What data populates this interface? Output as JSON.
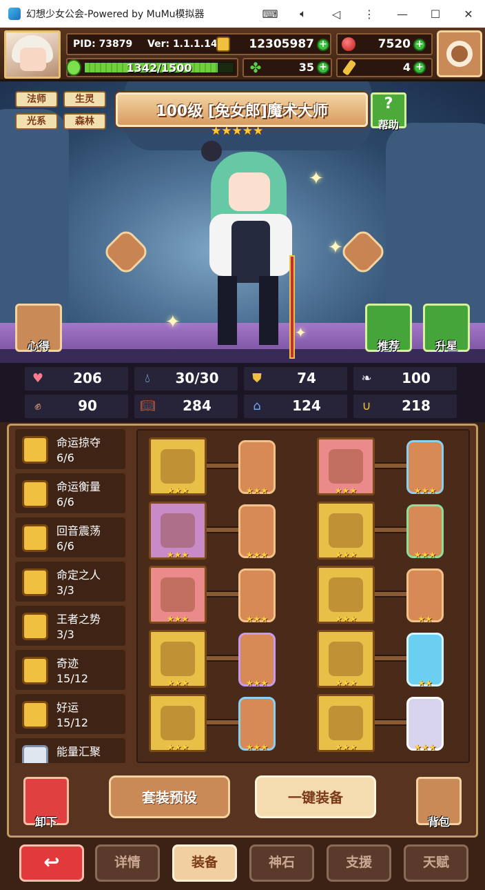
{
  "window": {
    "title": "幻想少女公会-Powered by MuMu模拟器",
    "controls": [
      "keyboard-icon",
      "volume-icon",
      "back-icon",
      "more-icon",
      "minimize-icon",
      "maximize-icon",
      "close-icon"
    ]
  },
  "resources": {
    "pid": "PID: 73879",
    "version": "Ver: 1.1.1.14",
    "gold": "12305987",
    "gems": "7520",
    "energy_text": "1342/1500",
    "energy_current": 1342,
    "energy_max": 1500,
    "clover": "35",
    "keys": "4"
  },
  "hero": {
    "tags": [
      "法师",
      "生灵",
      "光系",
      "森林"
    ],
    "title": "100级 [兔女郎]魔术大师",
    "stars": 5,
    "help_label": "帮助",
    "insight_label": "心得",
    "recommend_label": "推荐",
    "starup_label": "升星"
  },
  "stats": [
    {
      "icon": "heart-icon",
      "value": "206"
    },
    {
      "icon": "water-drop-icon",
      "value": "30/30"
    },
    {
      "icon": "shield-icon",
      "value": "74"
    },
    {
      "icon": "wing-icon",
      "value": "100"
    },
    {
      "icon": "fist-icon",
      "value": "90"
    },
    {
      "icon": "book-icon",
      "value": "284"
    },
    {
      "icon": "boot-icon",
      "value": "124"
    },
    {
      "icon": "horseshoe-icon",
      "value": "218"
    }
  ],
  "sets": [
    {
      "name": "命运掠夺",
      "count": "6/6"
    },
    {
      "name": "命运衡量",
      "count": "6/6"
    },
    {
      "name": "回音震荡",
      "count": "6/6"
    },
    {
      "name": "命定之人",
      "count": "3/3"
    },
    {
      "name": "王者之势",
      "count": "3/3"
    },
    {
      "name": "奇迹",
      "count": "15/12"
    },
    {
      "name": "好运",
      "count": "15/12"
    },
    {
      "name": "能量汇聚",
      "count": ""
    }
  ],
  "equipment": {
    "left": [
      {
        "item": "axe-icon",
        "frame": "gold",
        "stars": "★★★",
        "rune_border": "normal",
        "rune_stars": "★★★"
      },
      {
        "item": "orb-icon",
        "frame": "purple",
        "stars": "★★★",
        "rune_border": "normal",
        "rune_stars": "★★★"
      },
      {
        "item": "necklace-icon",
        "frame": "pink",
        "stars": "★★★",
        "rune_border": "normal",
        "rune_stars": "★★★"
      },
      {
        "item": "amulet-icon",
        "frame": "gold",
        "stars": "★★★",
        "rune_border": "purple",
        "rune_stars": "★★★"
      },
      {
        "item": "ring-icon",
        "frame": "gold",
        "stars": "★★★",
        "rune_border": "blue",
        "rune_stars": "★★★"
      }
    ],
    "right": [
      {
        "item": "hat-icon",
        "frame": "pink",
        "stars": "★★★",
        "rune_border": "blue",
        "rune_stars": "★★★"
      },
      {
        "item": "armor-icon",
        "frame": "gold",
        "stars": "★★★",
        "rune_border": "green",
        "rune_stars": "★★★"
      },
      {
        "item": "bracer-icon",
        "frame": "gold",
        "stars": "★★★",
        "rune_border": "normal",
        "rune_stars": "★★"
      },
      {
        "item": "belt-icon",
        "frame": "gold",
        "stars": "★★★",
        "rune_border": "cyan",
        "rune_stars": "★★"
      },
      {
        "item": "boots-icon",
        "frame": "gold",
        "stars": "★★★",
        "rune_border": "silver",
        "rune_stars": "★★★"
      }
    ]
  },
  "actions": {
    "unequip_label": "卸下",
    "preset_label": "套装预设",
    "equip_all_label": "一键装备",
    "bag_label": "背包"
  },
  "nav": {
    "back_icon": "return-arrow-icon",
    "tabs": [
      "详情",
      "装备",
      "神石",
      "支援",
      "天赋"
    ],
    "active": "装备"
  },
  "colors": {
    "accent_gold": "#f0c040",
    "panel_brown": "#58331f",
    "active_tab": "#f2cfa0",
    "back_red": "#e23a3a"
  }
}
